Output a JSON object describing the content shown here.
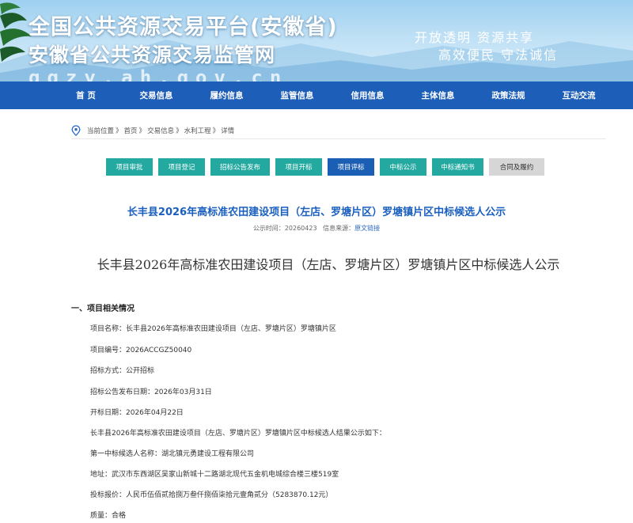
{
  "header": {
    "title_line1": "全国公共资源交易平台(安徽省)",
    "title_line2": "安徽省公共资源交易监管网",
    "url_text": "ggzy.ah.gov.cn",
    "slogan_line1": "开放透明  资源共享",
    "slogan_line2": "高效便民  守法诚信"
  },
  "nav": {
    "items": [
      {
        "label": "首 页"
      },
      {
        "label": "交易信息"
      },
      {
        "label": "履约信息"
      },
      {
        "label": "监管信息"
      },
      {
        "label": "信用信息"
      },
      {
        "label": "主体信息"
      },
      {
        "label": "政策法规"
      },
      {
        "label": "互动交流"
      }
    ]
  },
  "breadcrumb": {
    "items": [
      "当前位置",
      "首页",
      "交易信息",
      "水利工程",
      "详情"
    ],
    "separator": "》"
  },
  "tabs": [
    {
      "label": "项目审批",
      "state": "normal"
    },
    {
      "label": "项目登记",
      "state": "normal"
    },
    {
      "label": "招标公告发布",
      "state": "normal"
    },
    {
      "label": "项目开标",
      "state": "normal"
    },
    {
      "label": "项目评标",
      "state": "active"
    },
    {
      "label": "中标公示",
      "state": "normal"
    },
    {
      "label": "中标通知书",
      "state": "normal"
    },
    {
      "label": "合同及履约",
      "state": "disabled"
    }
  ],
  "article": {
    "title": "长丰县2026年高标准农田建设项目（左店、罗塘片区）罗塘镇片区中标候选人公示",
    "publish_label": "公示时间：",
    "publish_date": "20260423",
    "source_label": "信息来源：",
    "source_link": "原文链接",
    "subtitle": "长丰县2026年高标准农田建设项目（左店、罗塘片区）罗塘镇片区中标候选人公示",
    "section1": "一、项目相关情况",
    "lines": [
      "项目名称：长丰县2026年高标准农田建设项目（左店、罗塘片区）罗塘镇片区",
      "项目编号：2026ACCGZ50040",
      "招标方式：公开招标",
      "招标公告发布日期：2026年03月31日",
      "开标日期：2026年04月22日",
      "长丰县2026年高标准农田建设项目（左店、罗塘片区）罗塘镇片区中标候选人结果公示如下：",
      "第一中标候选人名称：湖北镇元勇建设工程有限公司",
      "地址：武汉市东西湖区吴家山新城十二路湖北现代五金机电城综合楼三楼519室",
      "投标报价：人民币伍佰贰拾捌万叁仟捌佰柒拾元壹角贰分（5283870.12元）",
      "质量：合格"
    ]
  },
  "colors": {
    "nav_bg": "#1d5eb8",
    "tab_bg": "#24a9a0",
    "tab_active_bg": "#1b5fb5",
    "title_color": "#1a5fbf"
  },
  "icons": {
    "location": "location-pin-icon"
  }
}
